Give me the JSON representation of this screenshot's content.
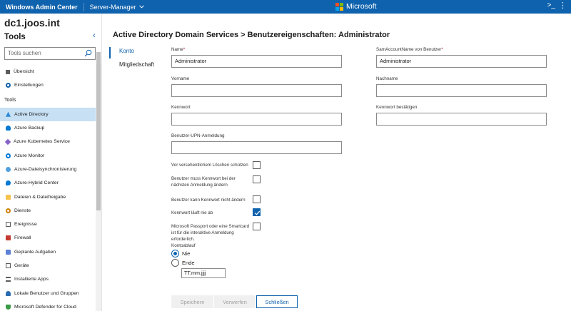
{
  "header": {
    "app_title": "Windows Admin Center",
    "manager": "Server-Manager",
    "brand": "Microsoft",
    "shell_icon": ">_",
    "colors": {
      "bar": "#0f62ad",
      "accent": "#0f62ad"
    }
  },
  "sidebar": {
    "server_name": "dc1.joos.int",
    "tools_title": "Tools",
    "search_placeholder": "Tools suchen",
    "top_items": [
      {
        "label": "Übersicht",
        "icon": "overview-icon"
      },
      {
        "label": "Einstellungen",
        "icon": "gear-icon"
      }
    ],
    "section_label": "Tools",
    "items": [
      {
        "label": "Active Directory",
        "icon": "active-directory-icon",
        "selected": true
      },
      {
        "label": "Azure Backup",
        "icon": "azure-backup-icon"
      },
      {
        "label": "Azure Kubernetes Service",
        "icon": "kubernetes-icon"
      },
      {
        "label": "Azure Monitor",
        "icon": "azure-monitor-icon"
      },
      {
        "label": "Azure-Dateisynchronisierung",
        "icon": "file-sync-icon"
      },
      {
        "label": "Azure-Hybrid Center",
        "icon": "hybrid-center-icon"
      },
      {
        "label": "Dateien & Dateifreigabe",
        "icon": "folder-icon"
      },
      {
        "label": "Dienste",
        "icon": "services-icon"
      },
      {
        "label": "Ereignisse",
        "icon": "events-icon"
      },
      {
        "label": "Firewall",
        "icon": "firewall-icon"
      },
      {
        "label": "Geplante Aufgaben",
        "icon": "scheduled-tasks-icon"
      },
      {
        "label": "Geräte",
        "icon": "devices-icon"
      },
      {
        "label": "Installierte Apps",
        "icon": "apps-icon"
      },
      {
        "label": "Lokale Benutzer und Gruppen",
        "icon": "users-icon"
      },
      {
        "label": "Microsoft Defender for Cloud",
        "icon": "defender-icon"
      }
    ]
  },
  "main": {
    "breadcrumb_parent": "Active Directory Domain Services",
    "breadcrumb_sep": ">",
    "breadcrumb_current": "Benutzereigenschaften: Administrator",
    "tabs": [
      {
        "label": "Konto"
      },
      {
        "label": "Mitgliedschaft"
      }
    ],
    "form": {
      "name_label": "Name",
      "name_value": "Administrator",
      "sam_label": "SamAccountName von Benutzer",
      "sam_value": "Administrator",
      "vorname_label": "Vorname",
      "nachname_label": "Nachname",
      "kennwort_label": "Kennwort",
      "kennwort_confirm_label": "Kennwort bestätigen",
      "upn_label": "Benutzer-UPN-Anmeldung",
      "required_mark": "*",
      "checkboxes": [
        {
          "label": "Vor versehentlichem Löschen schützen",
          "checked": false
        },
        {
          "label": "Benutzer muss Kennwort bei der nächsten Anmeldung ändern",
          "checked": false
        },
        {
          "label": "Benutzer kann Kennwort nicht ändern",
          "checked": false
        },
        {
          "label": "Kennwort läuft nie ab",
          "checked": true
        },
        {
          "label": "Microsoft Passport oder eine Smartcard ist für die interaktive Anmeldung erforderlich.",
          "checked": false
        }
      ],
      "expiry_label": "Kontoablauf",
      "radio_never": "Nie",
      "radio_end": "Ende",
      "date_placeholder": "TT.mm.jjjj",
      "selected_expiry": "Nie"
    },
    "buttons": {
      "save": "Speichern",
      "discard": "Verwerfen",
      "close": "Schließen"
    }
  }
}
